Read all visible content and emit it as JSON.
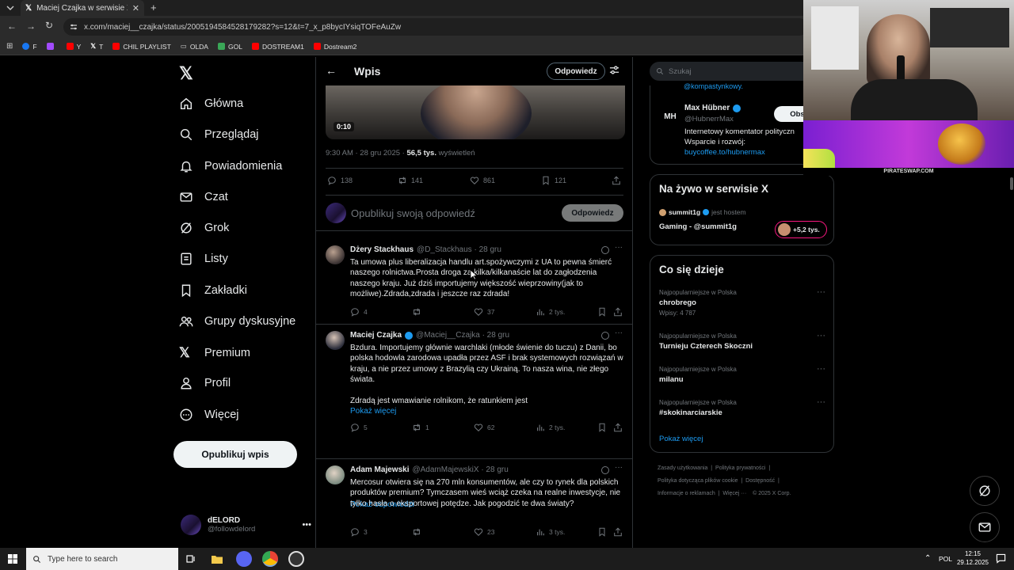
{
  "browser": {
    "tab_title": "Maciej Czajka w serwisie X: „Bo",
    "url": "x.com/maciej__czajka/status/2005194584528179282?s=12&t=7_x_p8bycIYsiqTOFeAuZw",
    "bookmarks": [
      {
        "label": "F",
        "color": "#1877f2"
      },
      {
        "label": "",
        "color": "#a24bff"
      },
      {
        "label": "Y",
        "color": "#ff0000"
      },
      {
        "label": "T",
        "color": "#ffffff"
      },
      {
        "label": "CHIL PLAYLIST",
        "color": "#ff0000"
      },
      {
        "label": "OLDA",
        "color": "#c9a227"
      },
      {
        "label": "GOL",
        "color": "#3aa757"
      },
      {
        "label": "DOSTREAM1",
        "color": "#ff0000"
      },
      {
        "label": "Dostream2",
        "color": "#ff0000"
      }
    ]
  },
  "nav": {
    "items": [
      {
        "label": "Główna",
        "icon": "home-icon"
      },
      {
        "label": "Przeglądaj",
        "icon": "search-icon"
      },
      {
        "label": "Powiadomienia",
        "icon": "bell-icon"
      },
      {
        "label": "Czat",
        "icon": "mail-icon"
      },
      {
        "label": "Grok",
        "icon": "grok-icon"
      },
      {
        "label": "Listy",
        "icon": "list-icon"
      },
      {
        "label": "Zakładki",
        "icon": "bookmark-icon"
      },
      {
        "label": "Grupy dyskusyjne",
        "icon": "people-icon"
      },
      {
        "label": "Premium",
        "icon": "x-logo-icon"
      },
      {
        "label": "Profil",
        "icon": "person-icon"
      },
      {
        "label": "Więcej",
        "icon": "more-circle-icon"
      }
    ],
    "post_button": "Opublikuj wpis",
    "account": {
      "name": "dELORD",
      "handle": "@followdelord"
    }
  },
  "header": {
    "title": "Wpis",
    "reply_button": "Odpowiedz"
  },
  "post": {
    "video_time": "0:10",
    "timestamp": "9:30 AM · 28 gru 2025 · ",
    "views": "56,5 tys.",
    "views_label": "wyświetleń",
    "replies": "138",
    "reposts": "141",
    "likes": "861",
    "bookmarks": "121"
  },
  "compose": {
    "placeholder": "Opublikuj swoją odpowiedź",
    "button": "Odpowiedz"
  },
  "replies": [
    {
      "name": "Dżery Stackhaus",
      "handle": "@D_Stackhaus · 28 gru",
      "text": "Ta umowa plus liberalizacja handlu art.spożywczymi z UA to pewna śmierć naszego rolnictwa.Prosta droga za kilka/kilkanaście lat do zagłodzenia naszego kraju. Już dziś importujemy większość wieprzowiny(jak to możliwe).Zdrada,zdrada i jeszcze raz zdrada!",
      "replies": "4",
      "reposts": "",
      "likes": "37",
      "views": "2 tys."
    },
    {
      "name": "Maciej Czajka",
      "handle": "@Maciej__Czajka · 28 gru",
      "text": "Bzdura. Importujemy głównie warchlaki (młode świenie do tuczu) z Danii, bo polska hodowla zarodowa upadła przez ASF i brak systemowych rozwiązań w kraju, a nie przez umowy z Brazylią czy Ukrainą. To nasza wina, nie złego świata.",
      "text2": "Zdradą jest wmawianie rolnikom, że ratunkiem jest",
      "more": "Pokaż więcej",
      "replies": "5",
      "reposts": "1",
      "likes": "62",
      "views": "2 tys.",
      "show_replies": "Pokaż odpowiedzi"
    },
    {
      "name": "Adam Majewski",
      "handle": "@AdamMajewskiX · 28 gru",
      "text": "Mercosur otwiera się na 270 mln konsumentów, ale czy to rynek dla polskich produktów premium? Tymczasem wieś wciąż czeka na realne inwestycje, nie tylko hasła o eksportowej potędze. Jak pogodzić te dwa światy?",
      "replies": "3",
      "reposts": "",
      "likes": "23",
      "views": "3 tys."
    }
  ],
  "right": {
    "search_placeholder": "Szukaj",
    "partial_link": "@kompastynkowy.",
    "suggested": {
      "name": "Max Hübner",
      "handle": "@HubnerrMax",
      "bio1": "Internetowy komentator polityczn",
      "bio2": "Wsparcie i rozwój:",
      "bio_link": "buycoffee.to/hubnermax",
      "follow": "Obse"
    },
    "live": {
      "title": "Na żywo w serwisie X",
      "host": "summit1g",
      "host_suffix": "jest hostem",
      "space": "Gaming - @summit1g",
      "listeners": "+5,2 tys."
    },
    "trends": {
      "title": "Co się dzieje",
      "items": [
        {
          "meta": "Najpopularniejsze w Polska",
          "name": "chrobrego",
          "count": "Wpisy: 4 787"
        },
        {
          "meta": "Najpopularniejsze w Polska",
          "name": "Turnieju Czterech Skoczni",
          "count": ""
        },
        {
          "meta": "Najpopularniejsze w Polska",
          "name": "milanu",
          "count": ""
        },
        {
          "meta": "Najpopularniejsze w Polska",
          "name": "#skokinarciarskie",
          "count": ""
        }
      ],
      "show_more": "Pokaż więcej"
    },
    "footer": {
      "line1": [
        "Zasady użytkowania",
        "Polityka prywatności"
      ],
      "line2": [
        "Polityka dotycząca plików cookie",
        "Dostępność"
      ],
      "line3": [
        "Informacje o reklamach",
        "Więcej ···",
        "© 2025 X Corp."
      ]
    }
  },
  "overlay": {
    "banner_caption": "PIRATESWAP.COM"
  },
  "taskbar": {
    "search_placeholder": "Type here to search",
    "lang": "POL",
    "time": "12:15",
    "date": "29.12.2025"
  }
}
